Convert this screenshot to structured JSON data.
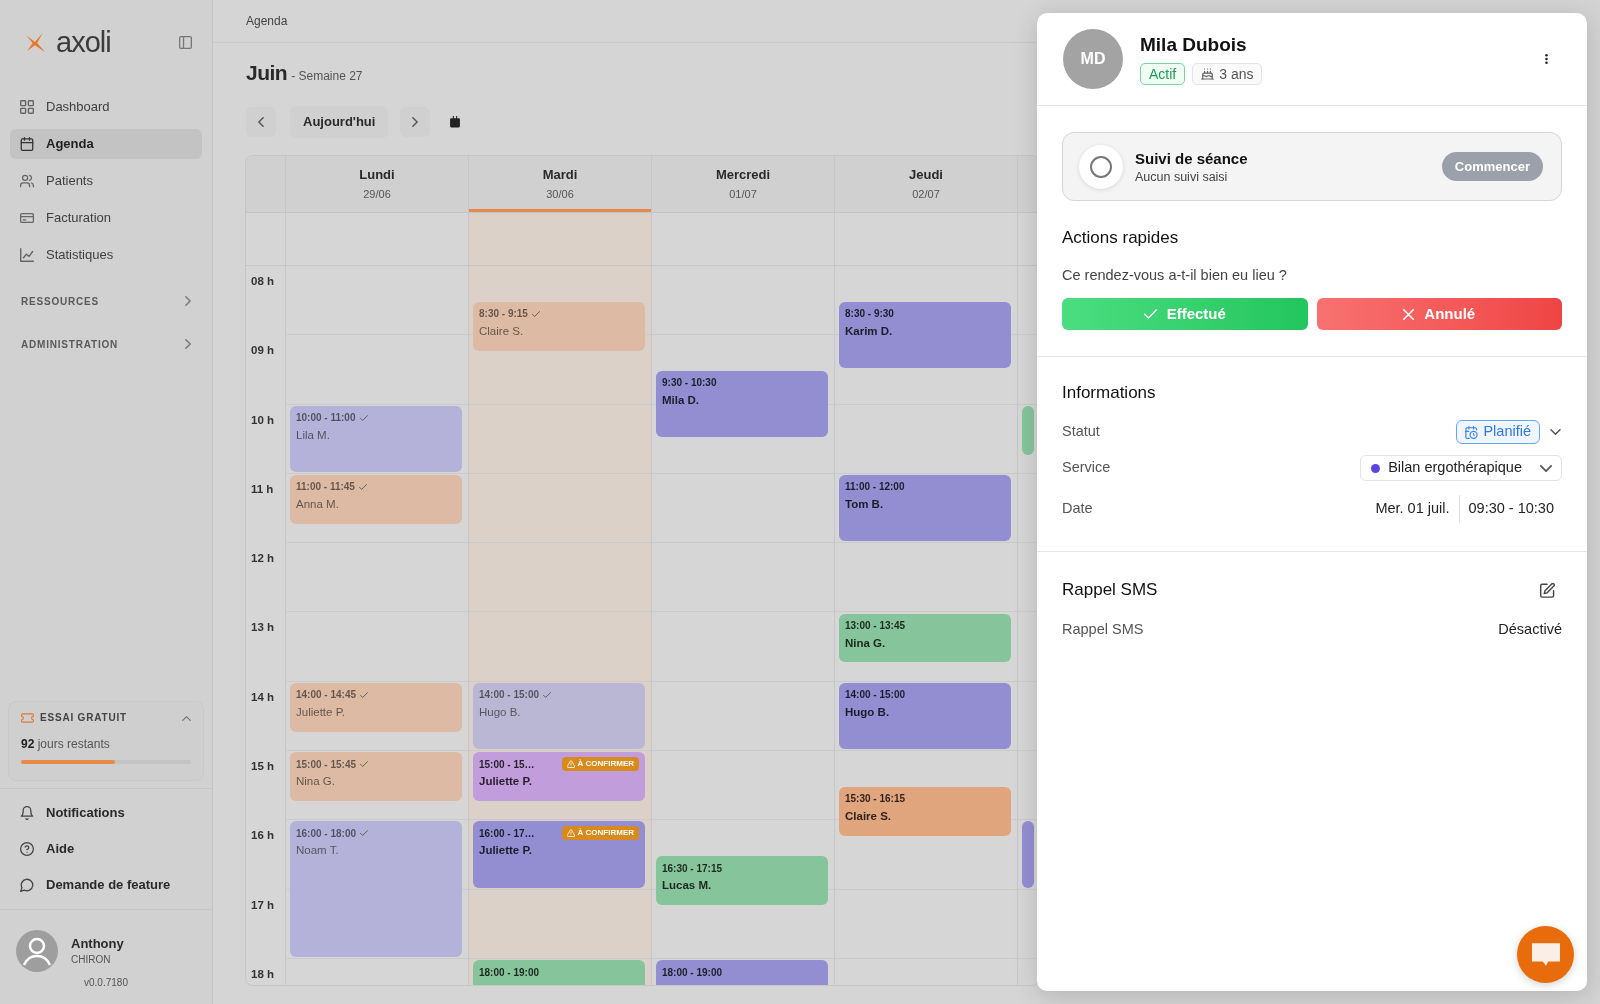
{
  "sidebar": {
    "logo": "axoli",
    "nav": [
      {
        "label": "Dashboard",
        "selected": false
      },
      {
        "label": "Agenda",
        "selected": true
      },
      {
        "label": "Patients",
        "selected": false
      },
      {
        "label": "Facturation",
        "selected": false
      },
      {
        "label": "Statistiques",
        "selected": false
      }
    ],
    "sections": [
      {
        "label": "RESSOURCES",
        "expanded": false
      },
      {
        "label": "ADMINISTRATION",
        "expanded": false
      }
    ],
    "trial": {
      "title": "ESSAI GRATUIT",
      "remaining": "**92** jours restants",
      "level": 0.55
    },
    "links": [
      "Notifications",
      "Aide",
      "Demande de feature"
    ],
    "user": {
      "first_name": "Anthony",
      "last_name": "CHIRON",
      "version": "v0.0.7180"
    }
  },
  "breadcrumb": "Agenda",
  "calendar": {
    "month": "Juin",
    "week": "- Semaine 27",
    "today_button": "Aujourd'hui",
    "hours": [
      "08 h",
      "09 h",
      "10 h",
      "11 h",
      "12 h",
      "13 h",
      "14 h",
      "15 h",
      "16 h",
      "17 h",
      "18 h"
    ],
    "days": [
      {
        "name": "Lundi",
        "date": "29/06",
        "today": false,
        "events": [
          {
            "time": "10:00 - 11:00",
            "patient": "Lila M.",
            "color": "#b4b2d8",
            "done": true
          },
          {
            "time": "11:00 - 11:45",
            "patient": "Anna M.",
            "color": "#dcbaa4",
            "done": true
          },
          {
            "time": "14:00 - 14:45",
            "patient": "Juliette P.",
            "color": "#dcbaa4",
            "done": true
          },
          {
            "time": "15:00 - 15:45",
            "patient": "Nina G.",
            "color": "#dcbaa4",
            "done": true
          },
          {
            "time": "16:00 - 18:00",
            "patient": "Noam T.",
            "color": "#b4b2d8",
            "done": true
          }
        ]
      },
      {
        "name": "Mardi",
        "date": "30/06",
        "today": true,
        "events": [
          {
            "time": "8:30 - 9:15",
            "patient": "Claire S.",
            "color": "#dcbaa4",
            "done": true
          },
          {
            "time": "14:00 - 15:00",
            "patient": "Hugo B.",
            "color": "#b9b7d3",
            "done": true
          },
          {
            "time": "15:00 - 15…",
            "patient": "Juliette P.",
            "badge": "À CONFIRMER",
            "color": "#c19ddc",
            "done": false
          },
          {
            "time": "16:00 - 17…",
            "patient": "Juliette P.",
            "badge": "À CONFIRMER",
            "color": "#938ed2",
            "done": false
          },
          {
            "time": "18:00 - 19:00",
            "color": "#86c59c",
            "done": false
          }
        ]
      },
      {
        "name": "Mercredi",
        "date": "01/07",
        "today": false,
        "events": [
          {
            "time": "9:30 - 10:30",
            "patient": "Mila D.",
            "color": "#938ed2",
            "done": false
          },
          {
            "time": "16:30 - 17:15",
            "patient": "Lucas M.",
            "color": "#86c59c",
            "done": false
          },
          {
            "time": "18:00 - 19:00",
            "color": "#938ed2",
            "done": false
          }
        ]
      },
      {
        "name": "Jeudi",
        "date": "02/07",
        "today": false,
        "events": [
          {
            "time": "8:30 - 9:30",
            "patient": "Karim D.",
            "color": "#938ed2",
            "done": false
          },
          {
            "time": "11:00 - 12:00",
            "patient": "Tom B.",
            "color": "#938ed2",
            "done": false
          },
          {
            "time": "13:00 - 13:45",
            "patient": "Nina G.",
            "color": "#86c59c",
            "done": false
          },
          {
            "time": "14:00 - 15:00",
            "patient": "Hugo B.",
            "color": "#938ed2",
            "done": false
          },
          {
            "time": "15:30 - 16:15",
            "patient": "Claire S.",
            "color": "#e0a57c",
            "done": false
          }
        ]
      },
      {
        "today": false,
        "events": [
          {
            "color": "#86c59c",
            "done": false
          },
          {
            "color": "#938ed2",
            "done": false
          }
        ]
      }
    ]
  },
  "drawer": {
    "patient": {
      "initials": "MD",
      "name": "Mila Dubois",
      "status": "Actif",
      "age": "3 ans"
    },
    "session_tracking": {
      "title": "Suivi de séance",
      "subtitle": "Aucun suivi saisi",
      "checked": false,
      "button": "Commencer"
    },
    "quick_actions": {
      "title": "Actions rapides",
      "question": "Ce rendez-vous a-t-il bien eu lieu ?",
      "buttons": [
        {
          "label": "Effectué",
          "kind": "confirm"
        },
        {
          "label": "Annulé",
          "kind": "cancel"
        }
      ]
    },
    "information": {
      "title": "Informations",
      "rows": [
        {
          "kind": "status",
          "label": "Statut",
          "value": "Planifié"
        },
        {
          "kind": "select",
          "label": "Service",
          "value": "Bilan ergothérapique"
        },
        {
          "kind": "date",
          "label": "Date",
          "date": "Mer. 01 juil.",
          "time": "09:30 - 10:30"
        }
      ]
    },
    "sms_reminder": {
      "title": "Rappel SMS",
      "label": "Rappel SMS",
      "value": "Désactivé"
    }
  }
}
